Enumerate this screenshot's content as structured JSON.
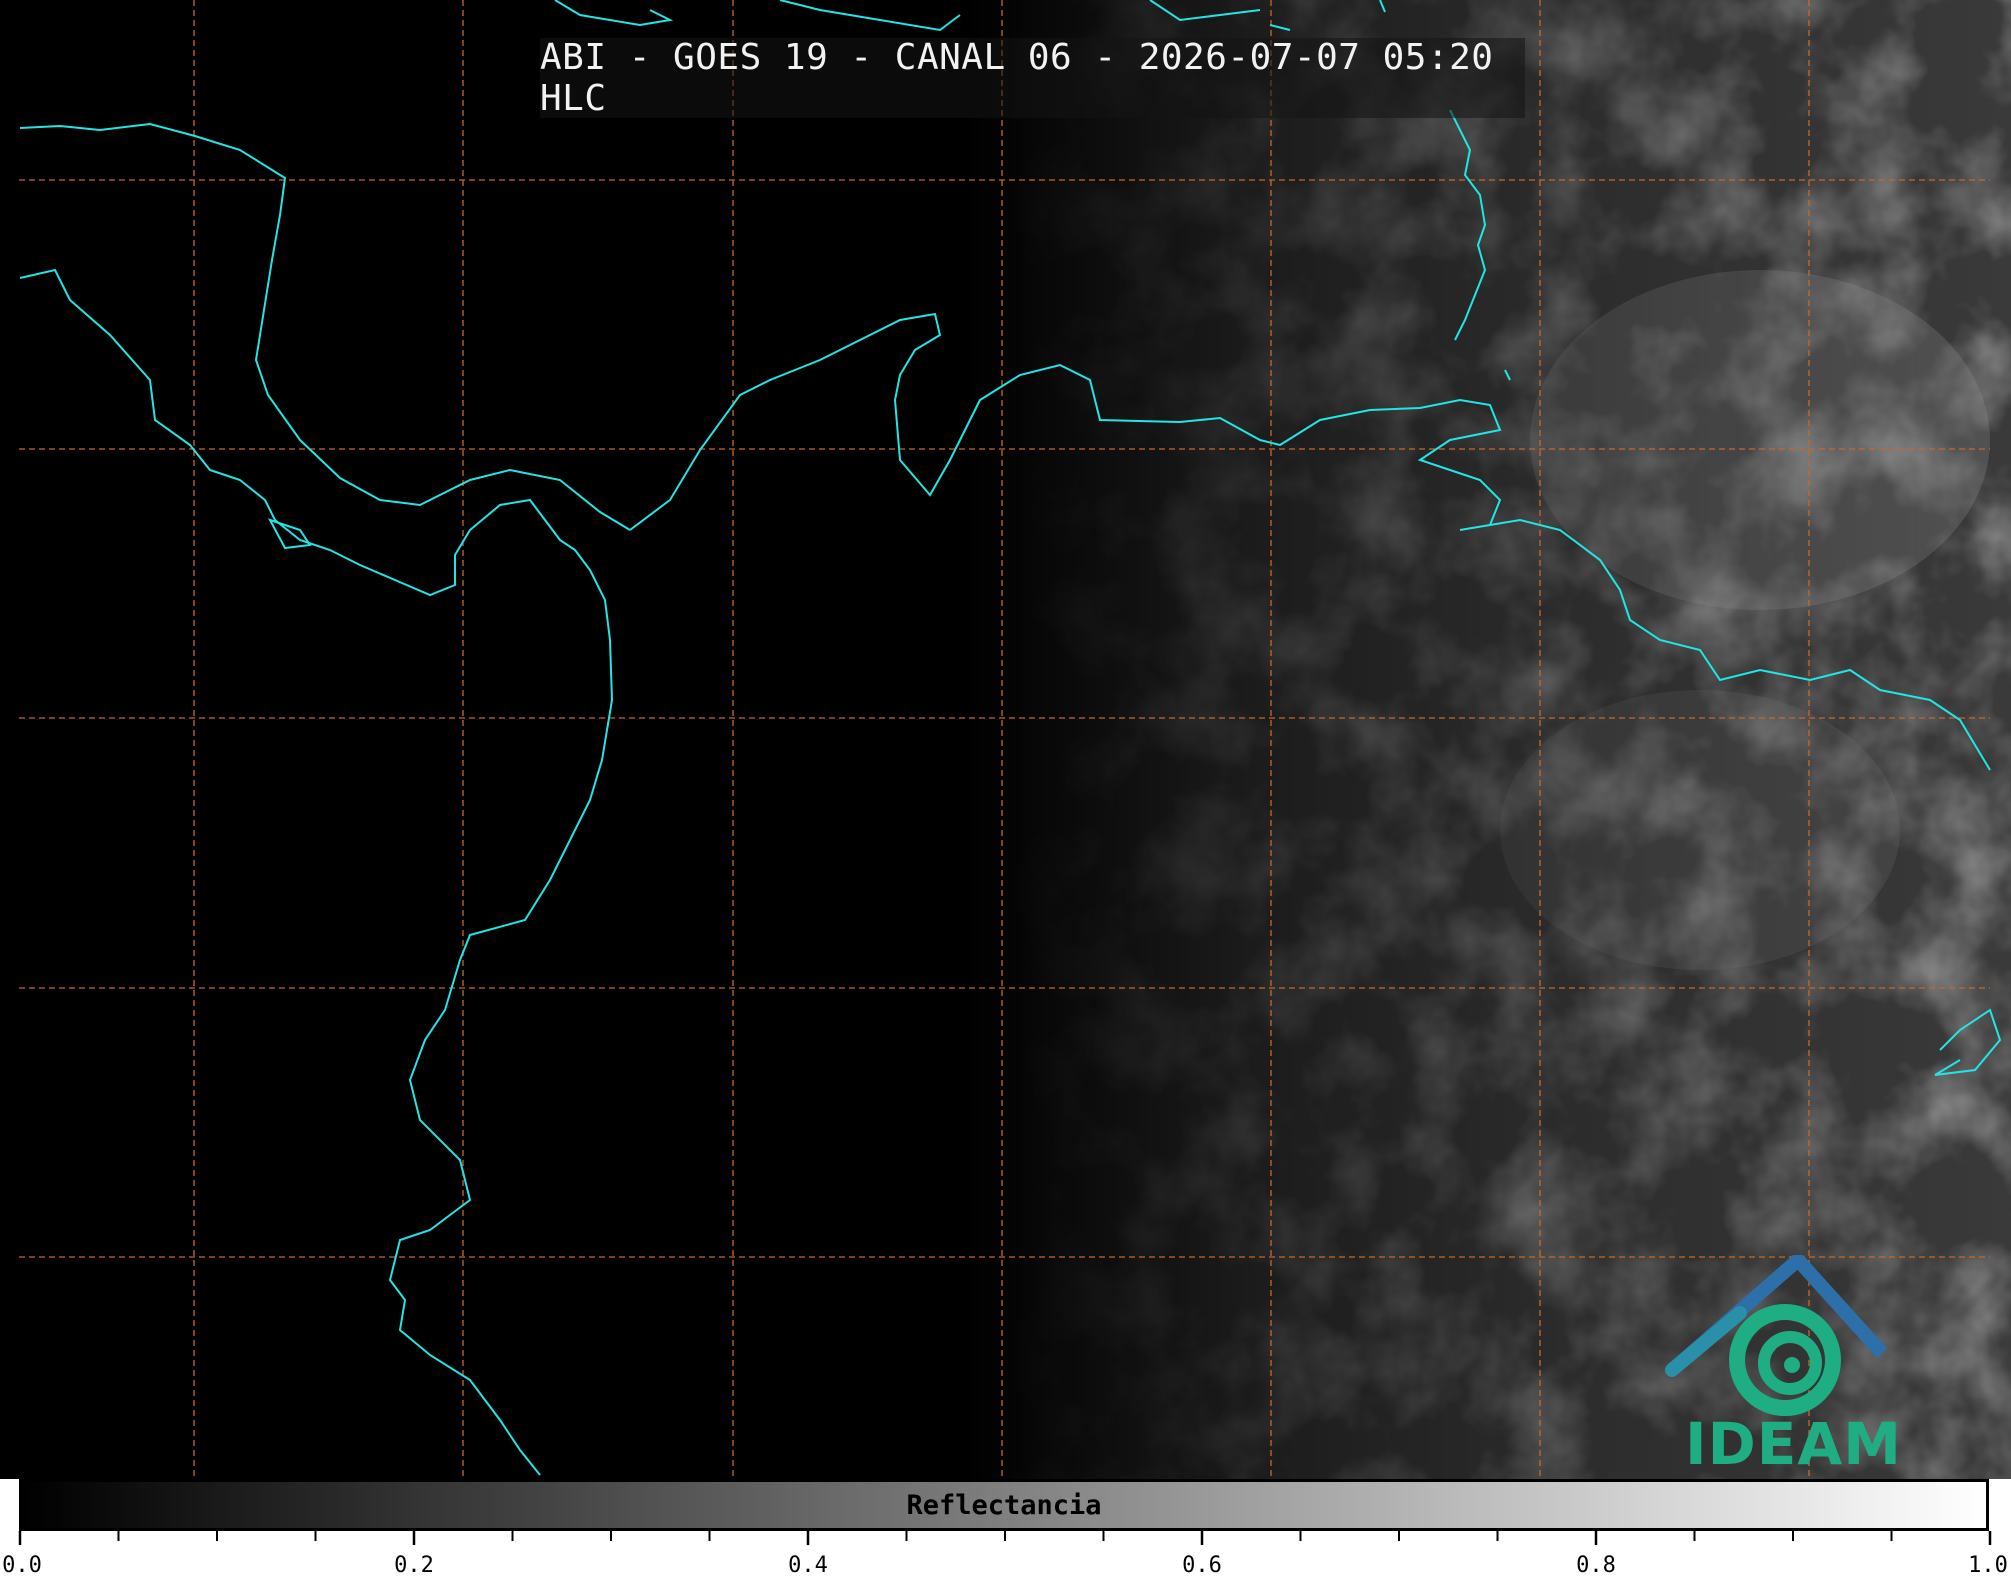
{
  "header": {
    "title": "ABI - GOES 19 - CANAL 06 - 2026-07-07 05:20 HLC"
  },
  "colorbar": {
    "label": "Reflectancia",
    "ticks": [
      "0.0",
      "0.2",
      "0.4",
      "0.6",
      "0.8",
      "1.0"
    ],
    "range": [
      0.0,
      1.0
    ],
    "colormap": [
      "#000000",
      "#ffffff"
    ]
  },
  "logo": {
    "text": "IDEAM",
    "colors": {
      "roof": "#2d6fa8",
      "swirl": "#1fae84"
    }
  },
  "map": {
    "coastline_color": "#22e5e5",
    "gridline_color": "#c8682a",
    "background": "#000000"
  }
}
